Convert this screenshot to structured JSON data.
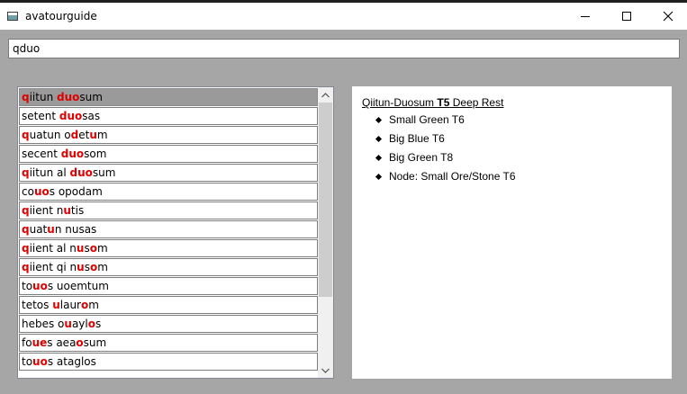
{
  "window": {
    "title": "avatourguide"
  },
  "search": {
    "value": "qduo"
  },
  "results": [
    {
      "parts": [
        [
          "q",
          1
        ],
        [
          "iitun ",
          0
        ],
        [
          "duo",
          1
        ],
        [
          "sum",
          0
        ]
      ],
      "selected": true
    },
    {
      "parts": [
        [
          "setent ",
          0
        ],
        [
          "duo",
          1
        ],
        [
          "sas",
          0
        ]
      ]
    },
    {
      "parts": [
        [
          "q",
          1
        ],
        [
          "uatun o",
          0
        ],
        [
          "d",
          1
        ],
        [
          "et",
          0
        ],
        [
          "u",
          1
        ],
        [
          "m",
          0
        ]
      ]
    },
    {
      "parts": [
        [
          "secent ",
          0
        ],
        [
          "duo",
          1
        ],
        [
          "som",
          0
        ]
      ]
    },
    {
      "parts": [
        [
          "q",
          1
        ],
        [
          "iitun al ",
          0
        ],
        [
          "duo",
          1
        ],
        [
          "sum",
          0
        ]
      ]
    },
    {
      "parts": [
        [
          "co",
          0
        ],
        [
          "uo",
          1
        ],
        [
          "s opodam",
          0
        ]
      ]
    },
    {
      "parts": [
        [
          "q",
          1
        ],
        [
          "iient n",
          0
        ],
        [
          "u",
          1
        ],
        [
          "tis",
          0
        ]
      ]
    },
    {
      "parts": [
        [
          "q",
          1
        ],
        [
          "uat",
          0
        ],
        [
          "u",
          1
        ],
        [
          "n nusas",
          0
        ]
      ]
    },
    {
      "parts": [
        [
          "q",
          1
        ],
        [
          "iient al n",
          0
        ],
        [
          "u",
          1
        ],
        [
          "s",
          0
        ],
        [
          "o",
          1
        ],
        [
          "m",
          0
        ]
      ]
    },
    {
      "parts": [
        [
          "q",
          1
        ],
        [
          "iient qi n",
          0
        ],
        [
          "u",
          1
        ],
        [
          "s",
          0
        ],
        [
          "o",
          1
        ],
        [
          "m",
          0
        ]
      ]
    },
    {
      "parts": [
        [
          "to",
          0
        ],
        [
          "uo",
          1
        ],
        [
          "s uoemtum",
          0
        ]
      ]
    },
    {
      "parts": [
        [
          "tetos ",
          0
        ],
        [
          "u",
          1
        ],
        [
          "laur",
          0
        ],
        [
          "o",
          1
        ],
        [
          "m",
          0
        ]
      ]
    },
    {
      "parts": [
        [
          "hebes o",
          0
        ],
        [
          "u",
          1
        ],
        [
          "ayl",
          0
        ],
        [
          "o",
          1
        ],
        [
          "s",
          0
        ]
      ]
    },
    {
      "parts": [
        [
          "fo",
          0
        ],
        [
          "ue",
          1
        ],
        [
          "s aea",
          0
        ],
        [
          "o",
          1
        ],
        [
          "sum",
          0
        ]
      ]
    },
    {
      "parts": [
        [
          "to",
          0
        ],
        [
          "uo",
          1
        ],
        [
          "s ataglos",
          0
        ]
      ]
    }
  ],
  "detail": {
    "title_prefix": "Qiitun-Duosum ",
    "title_bold": "T5",
    "title_suffix": " Deep Rest",
    "nodes": [
      "Small Green T6",
      "Big Blue T6",
      "Big Green T8",
      "Node: Small Ore/Stone T6"
    ]
  },
  "icons": {
    "app": "window-app-icon",
    "minimize": "minimize-icon",
    "maximize": "maximize-icon",
    "close": "close-icon",
    "scroll_up": "chevron-up-icon",
    "scroll_down": "chevron-down-icon"
  },
  "colors": {
    "highlight": "#e00000",
    "selected_row": "#9a9a9a",
    "background": "#a6a6a6"
  }
}
